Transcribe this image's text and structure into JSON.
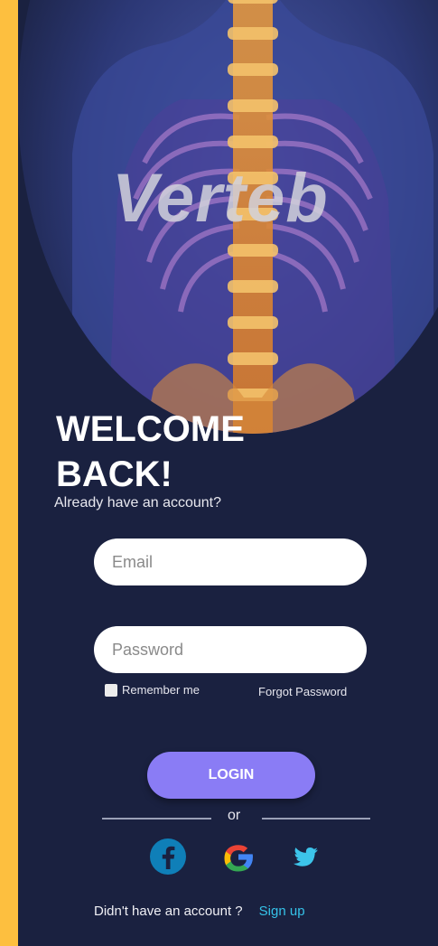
{
  "hero": {
    "image_icon": "spine-xray-illustration",
    "brand": "Verteb"
  },
  "welcome": {
    "line1": "WELCOME",
    "line2": "BACK!",
    "subtitle": "Already have an account?"
  },
  "form": {
    "email_placeholder": "Email",
    "email_value": "",
    "password_placeholder": "Password",
    "password_value": "",
    "remember_label": "Remember me",
    "forgot_label": "Forgot Password",
    "login_label": "LOGIN",
    "or_label": "or"
  },
  "social": {
    "facebook_icon": "facebook-icon",
    "google_icon": "google-icon",
    "twitter_icon": "twitter-icon"
  },
  "footer": {
    "prompt": "Didn't have an account ?",
    "signup_label": "Sign up"
  },
  "colors": {
    "sidebar": "#fdbf3f",
    "background": "#1a2140",
    "accent": "#8a7cf5",
    "link": "#35c2e8"
  }
}
